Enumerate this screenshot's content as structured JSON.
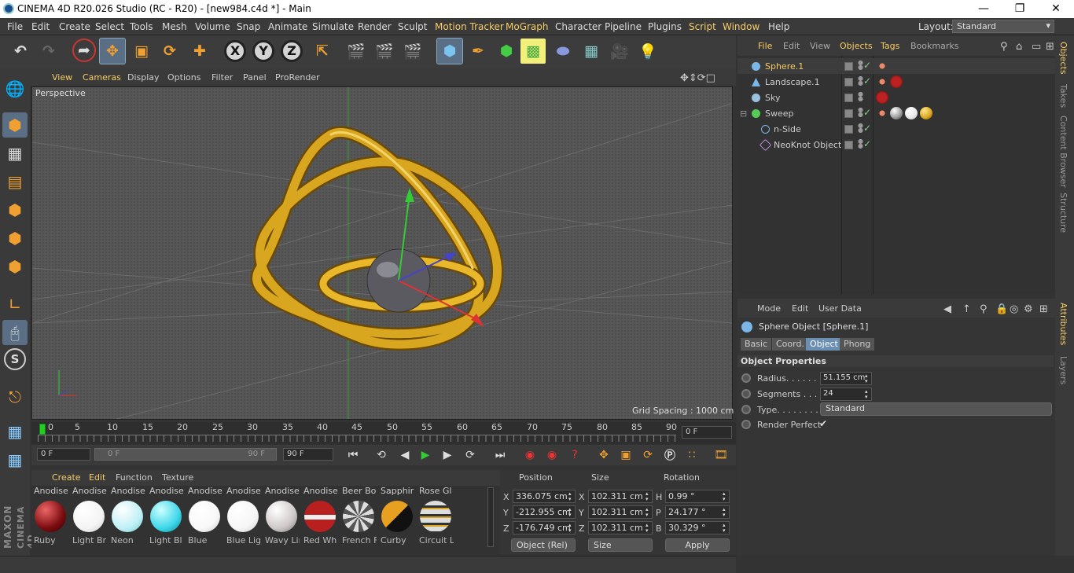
{
  "title": "CINEMA 4D R20.026 Studio (RC - R20) - [new984.c4d *] - Main",
  "window_controls": {
    "minimize": "—",
    "maximize": "❐",
    "close": "✕"
  },
  "menu": [
    "File",
    "Edit",
    "Create",
    "Select",
    "Tools",
    "Mesh",
    "Volume",
    "Snap",
    "Animate",
    "Simulate",
    "Render",
    "Sculpt",
    "Motion Tracker",
    "MoGraph",
    "Character",
    "Pipeline",
    "Plugins",
    "Script",
    "Window",
    "Help"
  ],
  "layout": {
    "label": "Layout:",
    "value": "Standard"
  },
  "axis_buttons": [
    "X",
    "Y",
    "Z"
  ],
  "viewport": {
    "menu": [
      "View",
      "Cameras",
      "Display",
      "Options",
      "Filter",
      "Panel",
      "ProRender"
    ],
    "label": "Perspective",
    "grid_spacing": "Grid Spacing : 1000 cm"
  },
  "timeline": {
    "ticks": [
      "0",
      "5",
      "10",
      "15",
      "20",
      "25",
      "30",
      "35",
      "40",
      "45",
      "50",
      "55",
      "60",
      "65",
      "70",
      "75",
      "80",
      "85",
      "90"
    ],
    "current": "0 F"
  },
  "playbar": {
    "start": "0 F",
    "range_start": "0 F",
    "range_end": "90 F",
    "end": "90 F"
  },
  "materials": {
    "menu": [
      "Create",
      "Edit",
      "Function",
      "Texture"
    ],
    "top_row": [
      "Anodise",
      "Anodise",
      "Anodise",
      "Anodise",
      "Anodise",
      "Anodise",
      "Anodise",
      "Anodise",
      "Beer Bo",
      "Sapphir",
      "Rose Gl"
    ],
    "items": [
      {
        "name": "Ruby",
        "color": "#7a0c10"
      },
      {
        "name": "Light Br",
        "color": "#f4f4f4"
      },
      {
        "name": "Neon",
        "color": "#bff0f6"
      },
      {
        "name": "Light Bl",
        "color": "#3fd7ea"
      },
      {
        "name": "Blue",
        "color": "#f8f8f8"
      },
      {
        "name": "Blue Lig",
        "color": "#f6f6f6"
      },
      {
        "name": "Wavy Lin",
        "color": "#cfc8c8"
      },
      {
        "name": "Red Wh",
        "color": "#b82020"
      },
      {
        "name": "French F",
        "color": "#555555"
      },
      {
        "name": "Curby",
        "color": "#e8a020"
      },
      {
        "name": "Circuit L",
        "color": "#a5a5a5"
      }
    ]
  },
  "brand": {
    "maxon": "MAXON",
    "product": "CINEMA 4D"
  },
  "coords": {
    "headers": [
      "Position",
      "Size",
      "Rotation"
    ],
    "rows": [
      {
        "pl": "X",
        "pv": "336.075 cm",
        "sl": "X",
        "sv": "102.311 cm",
        "rl": "H",
        "rv": "0.99 °"
      },
      {
        "pl": "Y",
        "pv": "-212.955 cm",
        "sl": "Y",
        "sv": "102.311 cm",
        "rl": "P",
        "rv": "24.177 °"
      },
      {
        "pl": "Z",
        "pv": "-176.749 cm",
        "sl": "Z",
        "sv": "102.311 cm",
        "rl": "B",
        "rv": "30.329 °"
      }
    ],
    "mode": "Object (Rel)",
    "size_mode": "Size",
    "apply": "Apply"
  },
  "objects": {
    "menu": [
      "File",
      "Edit",
      "View",
      "Objects",
      "Tags",
      "Bookmarks"
    ],
    "items": [
      {
        "name": "Sphere.1",
        "selected": true
      },
      {
        "name": "Landscape.1",
        "selected": false
      },
      {
        "name": "Sky",
        "selected": false
      },
      {
        "name": "Sweep",
        "selected": false
      },
      {
        "name": "n-Side",
        "selected": false
      },
      {
        "name": "NeoKnot Object",
        "selected": false
      }
    ]
  },
  "side_tabs": [
    "Objects",
    "Takes",
    "Content Browser",
    "Structure",
    "Attributes",
    "Layers"
  ],
  "attributes": {
    "menu": [
      "Mode",
      "Edit",
      "User Data"
    ],
    "object_title": "Sphere Object [Sphere.1]",
    "tabs": [
      "Basic",
      "Coord.",
      "Object",
      "Phong"
    ],
    "active_tab": "Object",
    "section": "Object Properties",
    "props": [
      {
        "label": "Radius. . . . . . .",
        "value": "51.155 cm"
      },
      {
        "label": "Segments . . . .",
        "value": "24"
      },
      {
        "label": "Type. . . . . . . . .",
        "value": "Standard"
      },
      {
        "label": "Render Perfect",
        "value": "✔"
      }
    ]
  },
  "colors": {
    "highlight": "#f6cc66",
    "tube": "#d9a620",
    "selection_blue": "#6b8fb3"
  }
}
